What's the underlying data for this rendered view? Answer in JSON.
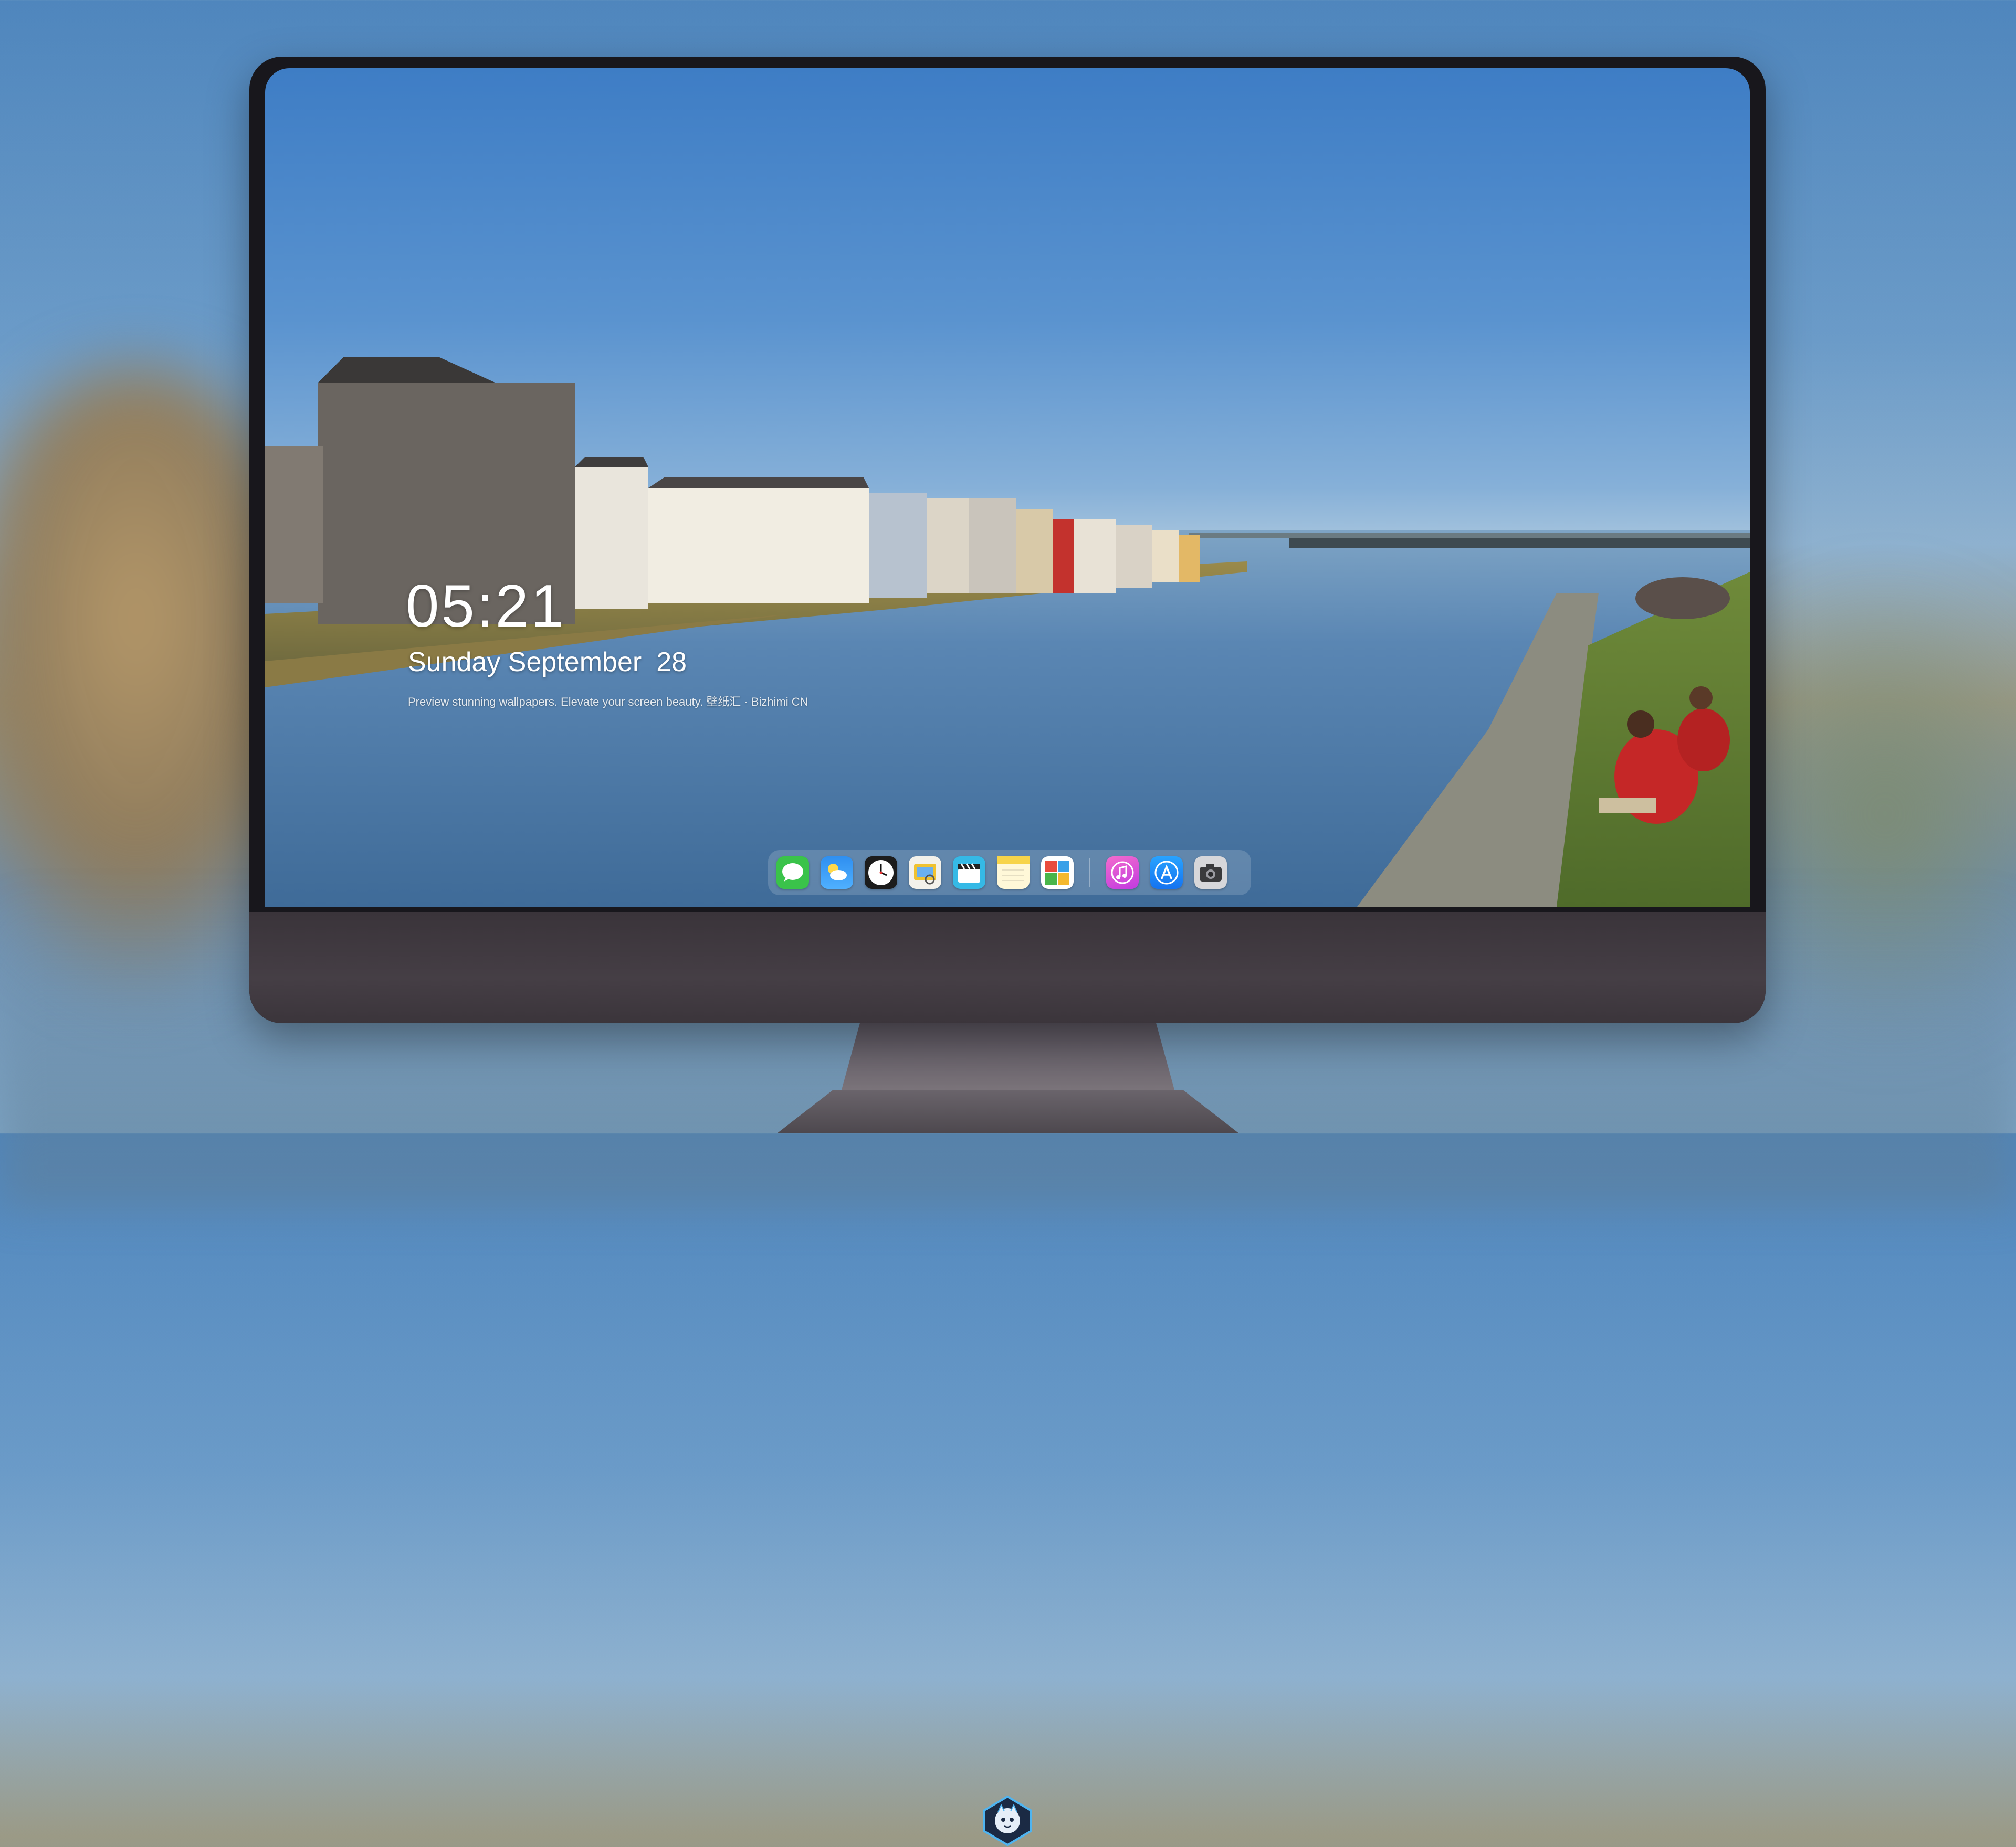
{
  "lockscreen": {
    "time": "05:21",
    "date_weekday_month": "Sunday September",
    "date_day": "28",
    "caption": "Preview stunning wallpapers. Elevate your screen beauty. 壁纸汇 · Bizhimi CN"
  },
  "dock": {
    "apps": [
      {
        "name": "messages-icon",
        "color": "#3ac34a"
      },
      {
        "name": "weather-icon",
        "color": "#2f8ff0"
      },
      {
        "name": "clock-icon",
        "color": "#1c1c1c"
      },
      {
        "name": "preview-icon",
        "color": "#f0c22f"
      },
      {
        "name": "clips-icon",
        "color": "#35b9e6"
      },
      {
        "name": "notes-icon",
        "color": "#f7d44a"
      },
      {
        "name": "photo-booth-icon",
        "color": "#e94b3c"
      },
      {
        "name": "music-icon",
        "color": "#f043b7"
      },
      {
        "name": "app-store-icon",
        "color": "#1a8ef5"
      },
      {
        "name": "camera-icon",
        "color": "#8a8a8e"
      }
    ]
  },
  "colors": {
    "sky_top": "#3e7dc5",
    "water": "#4d79a6",
    "monitor_frame": "#18171c",
    "monitor_chin": "#403a40"
  }
}
